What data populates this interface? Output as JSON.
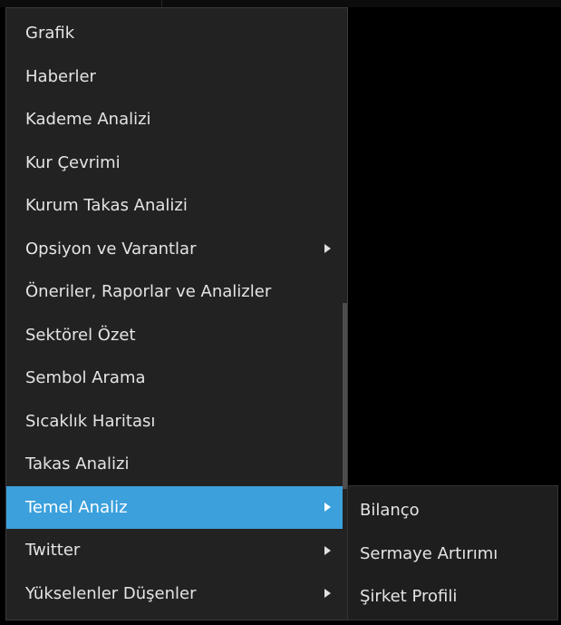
{
  "main_menu": {
    "items": [
      {
        "label": "Grafik",
        "has_submenu": false
      },
      {
        "label": "Haberler",
        "has_submenu": false
      },
      {
        "label": "Kademe Analizi",
        "has_submenu": false
      },
      {
        "label": "Kur Çevrimi",
        "has_submenu": false
      },
      {
        "label": "Kurum Takas Analizi",
        "has_submenu": false
      },
      {
        "label": "Opsiyon ve Varantlar",
        "has_submenu": true
      },
      {
        "label": "Öneriler, Raporlar ve Analizler",
        "has_submenu": false
      },
      {
        "label": "Sektörel Özet",
        "has_submenu": false
      },
      {
        "label": "Sembol Arama",
        "has_submenu": false
      },
      {
        "label": "Sıcaklık Haritası",
        "has_submenu": false
      },
      {
        "label": "Takas Analizi",
        "has_submenu": false
      },
      {
        "label": "Temel Analiz",
        "has_submenu": true,
        "active": true
      },
      {
        "label": "Twitter",
        "has_submenu": true
      },
      {
        "label": "Yükselenler Düşenler",
        "has_submenu": true
      }
    ]
  },
  "sub_menu": {
    "items": [
      {
        "label": "Bilanço"
      },
      {
        "label": "Sermaye Artırımı"
      },
      {
        "label": "Şirket Profili"
      }
    ]
  },
  "colors": {
    "menu_background": "#222222",
    "highlight": "#3ba0dc",
    "text": "#e4e4e4",
    "page_background": "#000000"
  },
  "icons": {
    "submenu_arrow": "chevron-right-icon"
  }
}
